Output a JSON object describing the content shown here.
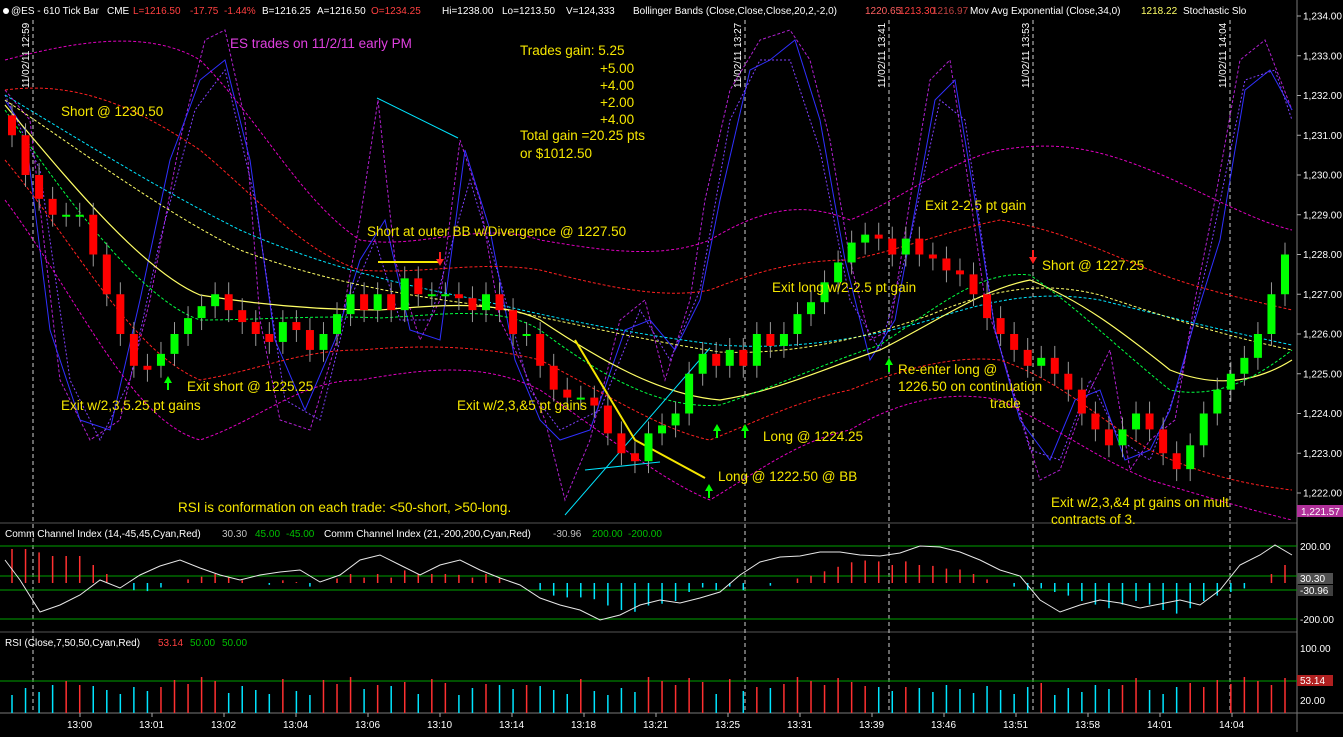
{
  "header": {
    "symbol": "@ES - 610 Tick Bar",
    "exchange": "CME",
    "last": "L=1216.50",
    "chg": "-17.75",
    "pct": "-1.44%",
    "bid": "B=1216.25",
    "ask": "A=1216.50",
    "open": "O=1234.25",
    "hi": "Hi=1238.00",
    "lo": "Lo=1213.50",
    "vol": "V=124,333",
    "bb_name": "Bollinger Bands (Close,Close,Close,20,2,-2,0)",
    "bb_v1": "1220.65",
    "bb_v2": "1213.30",
    "bb_v3": "1216.97",
    "ema_name": "Mov Avg Exponential (Close,34,0)",
    "ema_v": "1218.22",
    "stoch_name": "Stochastic Slo"
  },
  "cci_panel": {
    "title1": "Comm Channel Index (14,-45,45,Cyan,Red)",
    "v1": "30.30",
    "u1": "45.00",
    "l1": "-45.00",
    "title2": "Comm Channel Index (21,-200,200,Cyan,Red)",
    "v2": "-30.96",
    "u2": "200.00",
    "l2": "-200.00",
    "ticks": [
      "200.00",
      "-200.00"
    ],
    "tag1": "30.30",
    "tag2": "-30.96"
  },
  "rsi_panel": {
    "title": "RSI (Close,7,50,50,Cyan,Red)",
    "v": "53.14",
    "u": "50.00",
    "l": "50.00",
    "ticks": [
      "100.00",
      "20.00"
    ],
    "tag": "53.14"
  },
  "price_axis": {
    "ticks": [
      "1,234.00",
      "1,233.00",
      "1,232.00",
      "1,231.00",
      "1,230.00",
      "1,229.00",
      "1,228.00",
      "1,227.00",
      "1,226.00",
      "1,225.00",
      "1,224.00",
      "1,223.00",
      "1,222.00"
    ],
    "last_tag": "1,221.57"
  },
  "time_axis": [
    "13:00",
    "13:01",
    "13:02",
    "13:04",
    "13:06",
    "13:10",
    "13:14",
    "13:18",
    "13:21",
    "13:25",
    "13:31",
    "13:39",
    "13:46",
    "13:51",
    "13:58",
    "14:01",
    "14:04"
  ],
  "session_markers": [
    "11/02/11 12:59",
    "11/02/11 13:27",
    "11/02/11 13:41",
    "11/02/11 13:53",
    "11/02/11 14:04"
  ],
  "annotations": {
    "title": "ES trades on 11/2/11 early PM",
    "trades_gain": [
      "Trades gain:  5.25",
      "+5.00",
      "+4.00",
      "+2.00",
      "+4.00",
      "Total gain  =20.25 pts",
      "or $1012.50"
    ],
    "short1": "Short @ 1230.50",
    "exit1": "Exit short @ 1225.25",
    "exit1b": "Exit w/2,3,5.25 pt gains",
    "short2": "Short at outer BB w/Divergence @ 1227.50",
    "exit2": "Exit w/2,3,&5 pt gains",
    "long1": "Long @ 1222.50 @ BB",
    "long2": "Long @ 1224.25",
    "exit_long": "Exit long w/2-2.5 pt gain",
    "reenter": [
      "Re-enter long @",
      "1226.50 on continuation",
      "trade"
    ],
    "exit3": "Exit 2-2.5 pt gain",
    "short3": "Short @ 1227.25",
    "exit4": [
      "Exit w/2,3,&4 pt gains on mult",
      "contracts of 3."
    ],
    "rsi_note": "RSI is conformation on each trade: <50-short, >50-long."
  },
  "colors": {
    "up": "#00ff00",
    "down": "#ff0000",
    "annotation": "#f5e600",
    "title": "#e040e0",
    "ema": "#ffff66",
    "cyan": "#00e5ff"
  },
  "chart_data": {
    "type": "candlestick",
    "ylim": [
      1221.5,
      1234.4
    ],
    "opens": [
      1231.5,
      1231.0,
      1230.0,
      1229.4,
      1229.0,
      1229.0,
      1229.0,
      1228.0,
      1227.0,
      1226.0,
      1225.2,
      1225.2,
      1225.5,
      1226.0,
      1226.4,
      1226.7,
      1227.0,
      1226.6,
      1226.3,
      1226.0,
      1225.8,
      1226.3,
      1226.1,
      1225.6,
      1226.0,
      1226.5,
      1227.0,
      1226.6,
      1227.0,
      1226.6,
      1227.4,
      1227.0,
      1227.0,
      1227.0,
      1226.9,
      1226.6,
      1227.0,
      1226.6,
      1226.0,
      1226.0,
      1225.2,
      1224.6,
      1224.4,
      1224.4,
      1224.2,
      1223.5,
      1223.0,
      1222.8,
      1223.5,
      1223.7,
      1224.0,
      1225.0,
      1225.5,
      1225.2,
      1225.6,
      1225.2,
      1226.0,
      1225.7,
      1226.0,
      1226.5,
      1226.8,
      1227.3,
      1227.8,
      1228.3,
      1228.5,
      1228.4,
      1228.0,
      1228.4,
      1228.0,
      1227.9,
      1227.6,
      1227.5,
      1227.0,
      1226.4,
      1226.0,
      1225.6,
      1225.2,
      1225.4,
      1225.0,
      1224.6,
      1224.0,
      1223.6,
      1223.2,
      1223.6,
      1224.0,
      1223.6,
      1223.0,
      1222.6,
      1223.2,
      1224.0,
      1224.6,
      1225.0,
      1225.4,
      1226.0,
      1227.0
    ],
    "closes": [
      1231.0,
      1230.0,
      1229.4,
      1229.0,
      1229.0,
      1229.0,
      1228.0,
      1227.0,
      1226.0,
      1225.2,
      1225.1,
      1225.5,
      1226.0,
      1226.4,
      1226.7,
      1227.0,
      1226.6,
      1226.3,
      1226.0,
      1225.8,
      1226.3,
      1226.1,
      1225.6,
      1226.0,
      1226.5,
      1227.0,
      1226.6,
      1227.0,
      1226.6,
      1227.4,
      1227.0,
      1227.0,
      1227.0,
      1226.9,
      1226.6,
      1227.0,
      1226.6,
      1226.0,
      1226.0,
      1225.2,
      1224.6,
      1224.4,
      1224.4,
      1224.2,
      1223.5,
      1223.0,
      1222.8,
      1223.5,
      1223.7,
      1224.0,
      1225.0,
      1225.5,
      1225.2,
      1225.6,
      1225.2,
      1226.0,
      1225.7,
      1226.0,
      1226.5,
      1226.8,
      1227.3,
      1227.8,
      1228.3,
      1228.5,
      1228.4,
      1228.0,
      1228.4,
      1228.0,
      1227.9,
      1227.6,
      1227.5,
      1227.0,
      1226.4,
      1226.0,
      1225.6,
      1225.2,
      1225.4,
      1225.0,
      1224.6,
      1224.0,
      1223.6,
      1223.2,
      1223.6,
      1224.0,
      1223.6,
      1223.0,
      1222.6,
      1223.2,
      1224.0,
      1224.6,
      1225.0,
      1225.4,
      1226.0,
      1227.0,
      1228.0
    ]
  }
}
